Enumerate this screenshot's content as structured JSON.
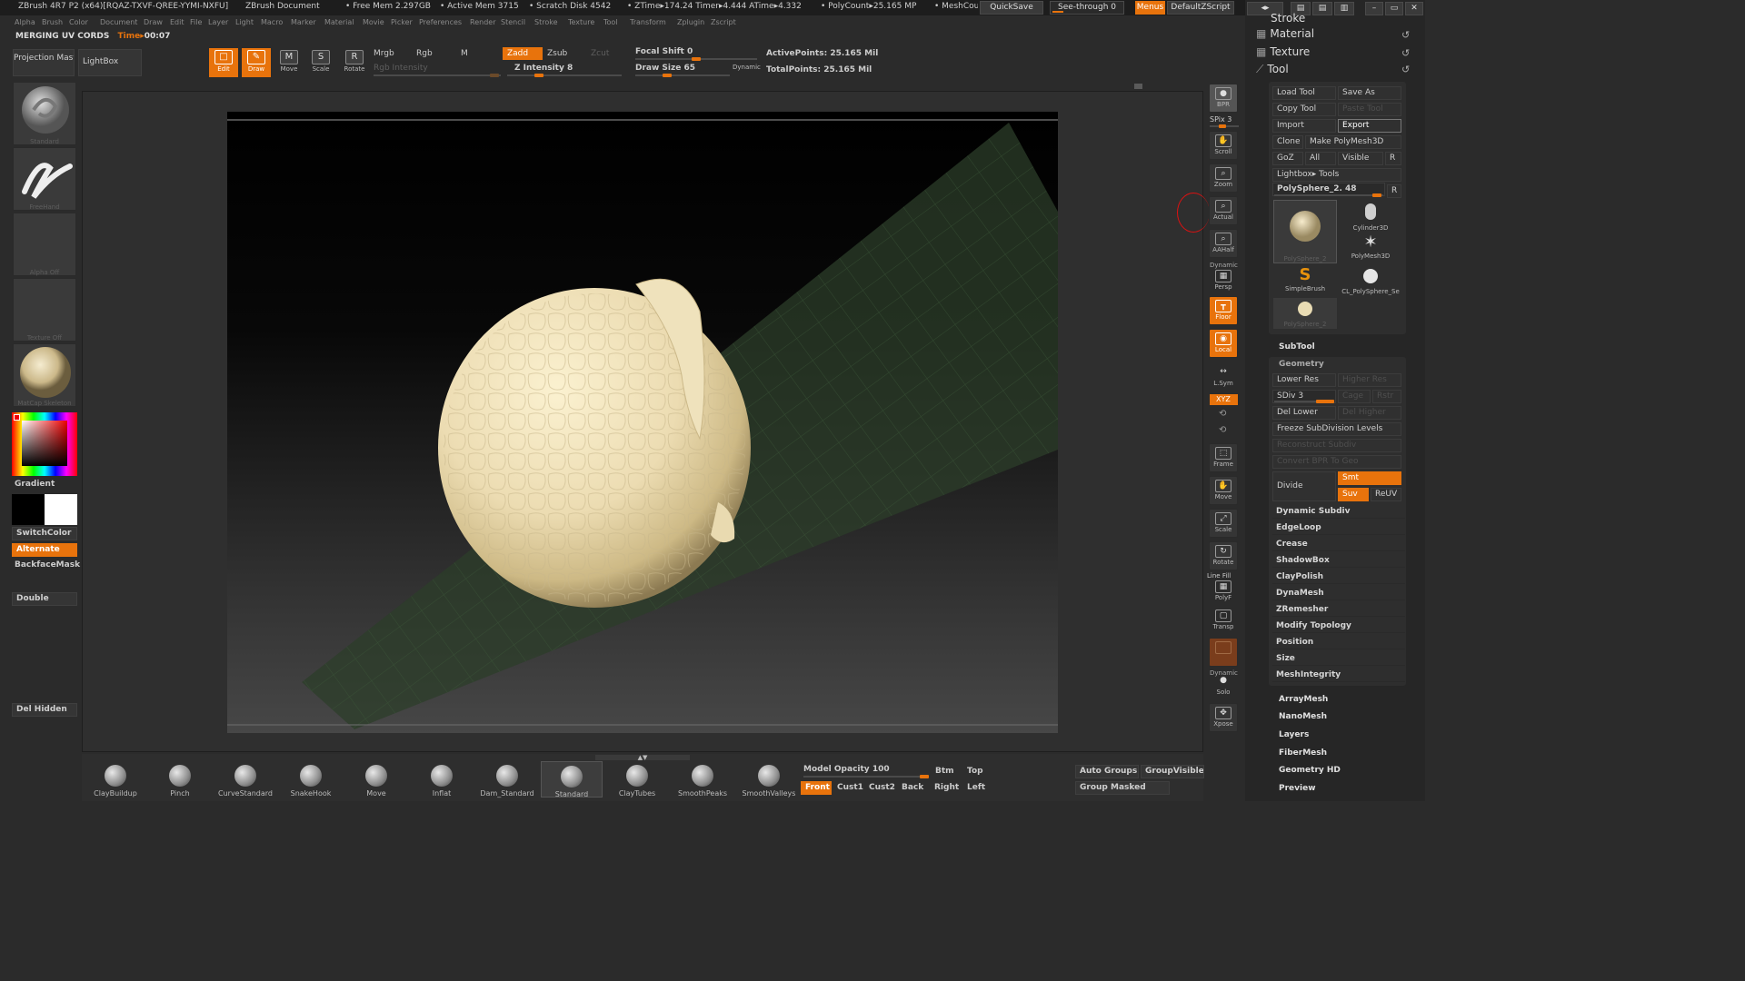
{
  "titlebar": {
    "app_title": "ZBrush 4R7 P2 (x64)[RQAZ-TXVF-QREE-YYMI-NXFU]",
    "doc_title": "ZBrush Document",
    "free_mem": "• Free Mem 2.297GB",
    "active_mem": "• Active Mem 3715",
    "scratch_disk": "• Scratch Disk 4542",
    "ztime": "• ZTime▸174.24 Timer▸4.444 ATime▸4.332",
    "polycount": "• PolyCount▸25.165 MP",
    "meshcount": "• MeshCou",
    "quicksave": "QuickSave",
    "see_through": "See-through  0",
    "menus": "Menus",
    "default_zscript": "DefaultZScript"
  },
  "menubar": [
    "Alpha",
    "Brush",
    "Color",
    "Document",
    "Draw",
    "Edit",
    "File",
    "Layer",
    "Light",
    "Macro",
    "Marker",
    "Material",
    "Movie",
    "Picker",
    "Preferences",
    "Render",
    "Stencil",
    "Stroke",
    "Texture",
    "Tool",
    "Transform",
    "Zplugin",
    "Zscript"
  ],
  "status": {
    "label": "MERGING UV CORDS",
    "time_label": "Time▸",
    "time_value": "00:07"
  },
  "top_left": {
    "projection_master": "Projection Master",
    "lightbox": "LightBox"
  },
  "transform_tools": [
    {
      "name": "edit",
      "label": "Edit",
      "glyph": "□"
    },
    {
      "name": "draw",
      "label": "Draw",
      "glyph": "✎"
    },
    {
      "name": "move",
      "label": "Move",
      "glyph": "M"
    },
    {
      "name": "scale",
      "label": "Scale",
      "glyph": "S"
    },
    {
      "name": "rotate",
      "label": "Rotate",
      "glyph": "R"
    }
  ],
  "draw_settings": {
    "mrgb": "Mrgb",
    "rgb": "Rgb",
    "m": "M",
    "zadd": "Zadd",
    "zsub": "Zsub",
    "zcut": "Zcut",
    "rgb_intensity": "Rgb Intensity",
    "z_intensity_label": "Z Intensity",
    "z_intensity_value": "8",
    "focal_shift_label": "Focal Shift",
    "focal_shift_value": "0",
    "draw_size_label": "Draw Size",
    "draw_size_value": "65",
    "dynamic": "Dynamic",
    "active_points": "ActivePoints: 25.165 Mil",
    "total_points": "TotalPoints: 25.165 Mil"
  },
  "left_panel": {
    "brush_caption": "Standard",
    "stroke_caption": "FreeHand",
    "alpha_caption": "Alpha Off",
    "texture_caption": "Texture Off",
    "material_caption": "MatCap Skeleton",
    "gradient": "Gradient",
    "switch_color": "SwitchColor",
    "alternate": "Alternate",
    "backface_mask": "BackfaceMask",
    "double": "Double",
    "del_hidden": "Del Hidden"
  },
  "right_dock": [
    {
      "name": "bpr",
      "label": "BPR",
      "glyph": "●"
    },
    {
      "name": "scroll",
      "label": "Scroll",
      "glyph": "✋"
    },
    {
      "name": "zoom",
      "label": "Zoom",
      "glyph": "⌕"
    },
    {
      "name": "actual",
      "label": "Actual",
      "glyph": "⌕"
    },
    {
      "name": "aahalf",
      "label": "AAHalf",
      "glyph": "⌕"
    },
    {
      "name": "persp",
      "label": "Persp",
      "glyph": "▦"
    },
    {
      "name": "floor",
      "label": "Floor",
      "glyph": "┳"
    },
    {
      "name": "local",
      "label": "Local",
      "glyph": "◉"
    },
    {
      "name": "lsym",
      "label": "L.Sym",
      "glyph": "↔"
    },
    {
      "name": "frame",
      "label": "Frame",
      "glyph": "⬚"
    },
    {
      "name": "move",
      "label": "Move",
      "glyph": "✋"
    },
    {
      "name": "scale",
      "label": "Scale",
      "glyph": "⤢"
    },
    {
      "name": "rotate",
      "label": "Rotate",
      "glyph": "↻"
    },
    {
      "name": "polyf",
      "label": "PolyF",
      "glyph": "▦"
    },
    {
      "name": "transp",
      "label": "Transp",
      "glyph": "▢"
    },
    {
      "name": "solo",
      "label": "Solo",
      "glyph": "●"
    },
    {
      "name": "xpose",
      "label": "Xpose",
      "glyph": "✥"
    }
  ],
  "right_dock_labels": {
    "spix": "SPix 3",
    "dynamic": "Dynamic",
    "line_fill": "Line Fill",
    "xyz": "XYZ",
    "dynamic2": "Dynamic"
  },
  "tool_panel": {
    "sections": [
      "Stroke",
      "Material",
      "Texture",
      "Tool"
    ],
    "load_tool": "Load Tool",
    "save_as": "Save As",
    "copy_tool": "Copy Tool",
    "paste_tool": "Paste Tool",
    "import": "Import",
    "export": "Export",
    "clone": "Clone",
    "make_polymesh": "Make PolyMesh3D",
    "goz": "GoZ",
    "all": "All",
    "visible": "Visible",
    "r": "R",
    "lightbox_tools": "Lightbox▸ Tools",
    "current_tool": "PolySphere_2. 48",
    "tool_items": [
      "PolySphere_2",
      "Cylinder3D",
      "PolyMesh3D",
      "SimpleBrush",
      "CL_PolySphere_Se",
      "PolySphere_2"
    ],
    "subtool": "SubTool",
    "geometry": "Geometry",
    "lower_res": "Lower Res",
    "higher_res": "Higher Res",
    "sdiv": "SDiv 3",
    "cage": "Cage",
    "rstr": "Rstr",
    "del_lower": "Del Lower",
    "del_higher": "Del Higher",
    "freeze": "Freeze SubDivision Levels",
    "reconstruct": "Reconstruct Subdiv",
    "convert_bpr": "Convert BPR To Geo",
    "divide": "Divide",
    "smt": "Smt",
    "suv": "Suv",
    "reuv": "ReUV",
    "geometry_items": [
      "Dynamic Subdiv",
      "EdgeLoop",
      "Crease",
      "ShadowBox",
      "ClayPolish",
      "DynaMesh",
      "ZRemesher",
      "Modify Topology",
      "Position",
      "Size",
      "MeshIntegrity"
    ],
    "sub_items": [
      "ArrayMesh",
      "NanoMesh",
      "Layers",
      "FiberMesh",
      "Geometry HD",
      "Preview"
    ]
  },
  "bottom_shelf": {
    "brushes": [
      "ClayBuildup",
      "Pinch",
      "CurveStandard",
      "SnakeHook",
      "Move",
      "Inflat",
      "Dam_Standard",
      "Standard",
      "ClayTubes",
      "SmoothPeaks",
      "SmoothValleys"
    ],
    "model_opacity_label": "Model Opacity",
    "model_opacity_value": "100",
    "btm": "Btm",
    "top": "Top",
    "front": "Front",
    "cust1": "Cust1",
    "cust2": "Cust2",
    "back": "Back",
    "right": "Right",
    "left": "Left",
    "auto_groups": "Auto Groups",
    "group_visible": "GroupVisible",
    "group_masked": "Group Masked"
  },
  "colors": {
    "accent": "#e8730c",
    "bg": "#2b2b2b",
    "clay": "#ece0bc"
  }
}
